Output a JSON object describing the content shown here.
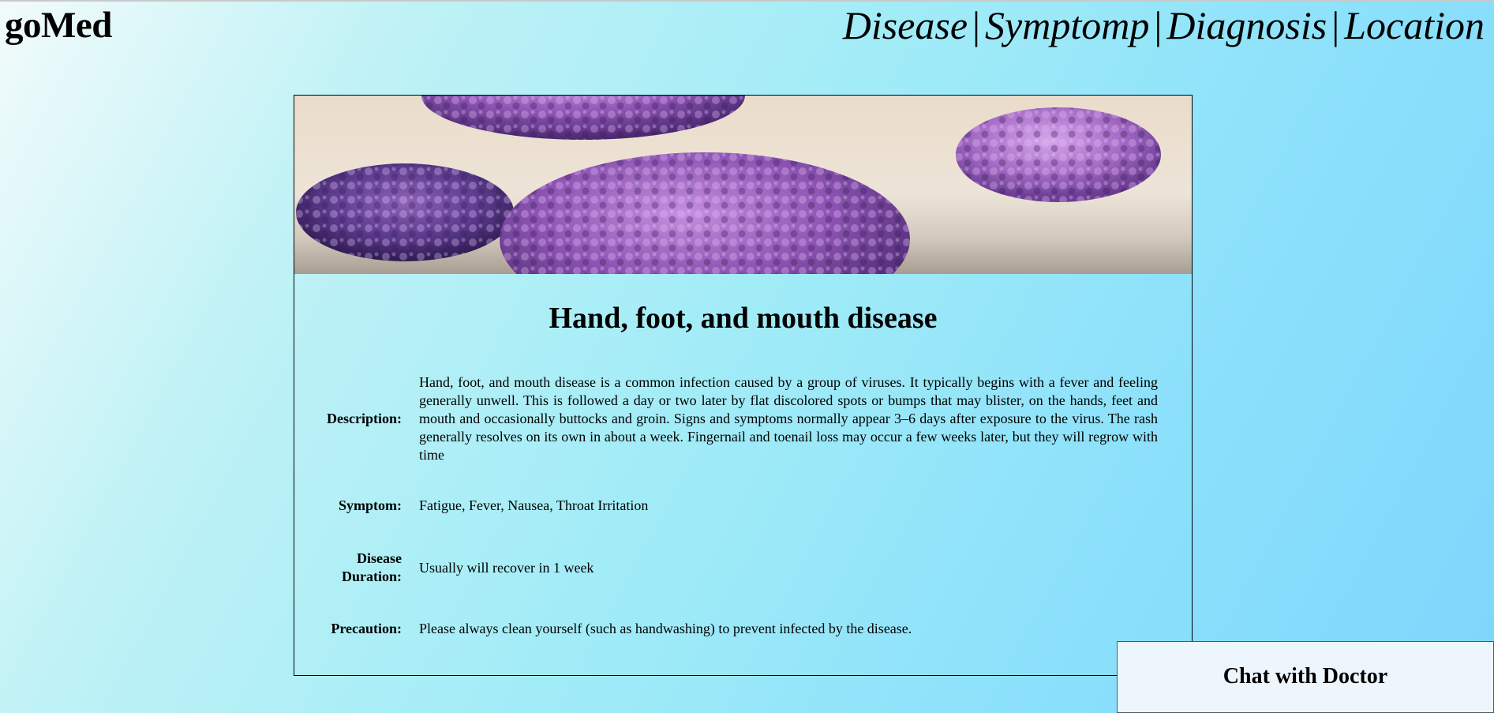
{
  "header": {
    "logo": "goMed",
    "nav": [
      {
        "label": "Disease"
      },
      {
        "label": "Symptomp"
      },
      {
        "label": "Diagnosis"
      },
      {
        "label": "Location"
      }
    ],
    "separator": "|"
  },
  "disease": {
    "banner_icon": "virus-banner-image",
    "title": "Hand, foot, and mouth disease",
    "fields": {
      "description": {
        "label": "Description:",
        "value": "Hand, foot, and mouth disease is a common infection caused by a group of viruses. It typically begins with a fever and feeling generally unwell. This is followed a day or two later by flat discolored spots or bumps that may blister, on the hands, feet and mouth and occasionally buttocks and groin. Signs and symptoms normally appear 3–6 days after exposure to the virus. The rash generally resolves on its own in about a week. Fingernail and toenail loss may occur a few weeks later, but they will regrow with time"
      },
      "symptom": {
        "label": "Symptom:",
        "value": "Fatigue, Fever, Nausea, Throat Irritation"
      },
      "duration": {
        "label_line1": "Disease",
        "label_line2": "Duration:",
        "value": "Usually will recover in 1 week"
      },
      "precaution": {
        "label": "Precaution:",
        "value": "Please always clean yourself (such as handwashing) to prevent infected by the disease."
      }
    }
  },
  "chat": {
    "label": "Chat with Doctor"
  }
}
